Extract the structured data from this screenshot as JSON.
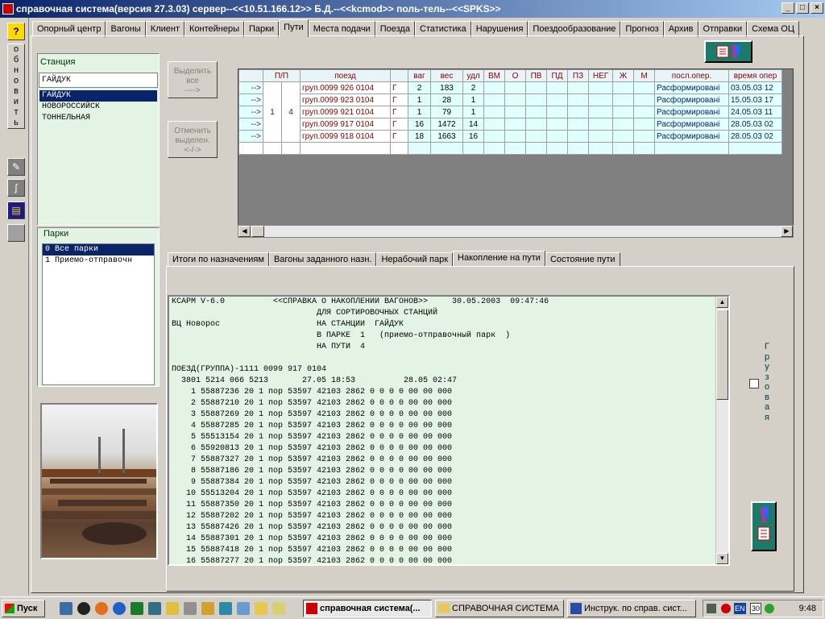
{
  "window": {
    "title": "справочная система(версия 27.3.03) сервер--<<10.51.166.12>> Б.Д.--<<kcmod>> поль-тель--<<SPKS>>",
    "min": "_",
    "max": "□",
    "close": "×"
  },
  "leftbar": {
    "help": "?",
    "refresh_letters": [
      "о",
      "б",
      "н",
      "о",
      "в",
      "и",
      "т",
      "ь"
    ]
  },
  "tabs": [
    "Опорный центр",
    "Вагоны",
    "Клиент",
    "Контейнеры",
    "Парки",
    "Пути",
    "Места подачи",
    "Поезда",
    "Статистика",
    "Нарушения",
    "Поездообразование",
    "Прогноз",
    "Архив",
    "Отправки",
    "Схема ОЦ"
  ],
  "active_tab": 5,
  "station": {
    "label": "Станция",
    "input": "ГАЙДУК",
    "items": [
      "ГАЙДУК",
      "НОВОРОССИЙСК",
      "ТОННЕЛЬНАЯ"
    ]
  },
  "parks": {
    "label": "Парки",
    "items": [
      "0   Все парки",
      "1   Приемо-отправочн"
    ]
  },
  "buttons": {
    "select_all": [
      "Выделить",
      "все",
      "---->"
    ],
    "deselect": [
      "Отменить",
      "выделен.",
      "<-/->"
    ]
  },
  "grid": {
    "headers": [
      "",
      "П/П",
      "",
      "поезд",
      "",
      "ваг",
      "вес",
      "удл",
      "ВМ",
      "О",
      "ПВ",
      "ПД",
      "ПЗ",
      "НЕГ",
      "Ж",
      "М",
      "посл.опер.",
      "время опер"
    ],
    "park": "1",
    "track": "4",
    "rows": [
      {
        "arrow": "-->",
        "train": "груп.0099 926 0104",
        "g": "Г",
        "wag": "2",
        "weight": "183",
        "len": "2",
        "op": "Расформировані",
        "time": "03.05.03 12"
      },
      {
        "arrow": "-->",
        "train": "груп.0099 923 0104",
        "g": "Г",
        "wag": "1",
        "weight": "28",
        "len": "1",
        "op": "Расформировані",
        "time": "15.05.03 17"
      },
      {
        "arrow": "-->",
        "train": "груп.0099 921 0104",
        "g": "Г",
        "wag": "1",
        "weight": "79",
        "len": "1",
        "op": "Расформировані",
        "time": "24.05.03 11"
      },
      {
        "arrow": "-->",
        "train": "груп.0099 917 0104",
        "g": "Г",
        "wag": "16",
        "weight": "1472",
        "len": "14",
        "op": "Расформировані",
        "time": "28.05.03 02"
      },
      {
        "arrow": "-->",
        "train": "груп.0099 918 0104",
        "g": "Г",
        "wag": "18",
        "weight": "1663",
        "len": "16",
        "op": "Расформировані",
        "time": "28.05.03 02"
      }
    ]
  },
  "subtabs": [
    "Итоги по назначениям",
    "Вагоны заданного назн.",
    "Нерабочий парк",
    "Накопление на пути",
    "Состояние пути"
  ],
  "active_subtab": 3,
  "report_lines": [
    "КСАРМ V-6.0          <<СПРАВКА О НАКОПЛЕНИИ ВАГОНОВ>>     30.05.2003  09:47:46",
    "                              ДЛЯ СОРТИРОВОЧНЫХ СТАНЦИЙ",
    "ВЦ Новорос                    НА СТАНЦИИ  ГАЙДУК",
    "                              В ПАРКЕ  1   (приемо-отправочный парк  )",
    "                              НА ПУТИ  4",
    "",
    "ПОЕЗД(ГРУППА)-1111 0099 917 0104",
    "  3801 5214 066 5213       27.05 18:53          28.05 02:47",
    "    1 55887236 20 1 пор 53597 42103 2862 0 0 0 0 00 00 000",
    "    2 55887210 20 1 пор 53597 42103 2862 0 0 0 0 00 00 000",
    "    3 55887269 20 1 пор 53597 42103 2862 0 0 0 0 00 00 000",
    "    4 55887285 20 1 пор 53597 42103 2862 0 0 0 0 00 00 000",
    "    5 55513154 20 1 пор 53597 42103 2862 0 0 0 0 00 00 000",
    "    6 55920813 20 1 пор 53597 42103 2862 0 0 0 0 00 00 000",
    "    7 55887327 20 1 пор 53597 42103 2862 0 0 0 0 00 00 000",
    "    8 55887186 20 1 пор 53597 42103 2862 0 0 0 0 00 00 000",
    "    9 55887384 20 1 пор 53597 42103 2862 0 0 0 0 00 00 000",
    "   10 55513204 20 1 пор 53597 42103 2862 0 0 0 0 00 00 000",
    "   11 55887350 20 1 пор 53597 42103 2862 0 0 0 0 00 00 000",
    "   12 55887202 20 1 пор 53597 42103 2862 0 0 0 0 00 00 000",
    "   13 55887426 20 1 пор 53597 42103 2862 0 0 0 0 00 00 000",
    "   14 55887301 20 1 пор 53597 42103 2862 0 0 0 0 00 00 000",
    "   15 55887418 20 1 пор 53597 42103 2862 0 0 0 0 00 00 000",
    "   16 55887277 20 1 пор 53597 42103 2862 0 0 0 0 00 00 000"
  ],
  "cargo_letters": [
    "Г",
    "р",
    "у",
    "з",
    "о",
    "в",
    "а",
    "я"
  ],
  "taskbar": {
    "start": "Пуск",
    "tasks": [
      "справочная система(...",
      "СПРАВОЧНАЯ СИСТЕМА",
      "Инструк. по справ. сист..."
    ],
    "lang": "EN",
    "day": "30",
    "clock": "9:48"
  },
  "colors": {
    "titlebar": "#0a246a",
    "header_text": "#8b0000",
    "panel": "#e4f4e4"
  }
}
